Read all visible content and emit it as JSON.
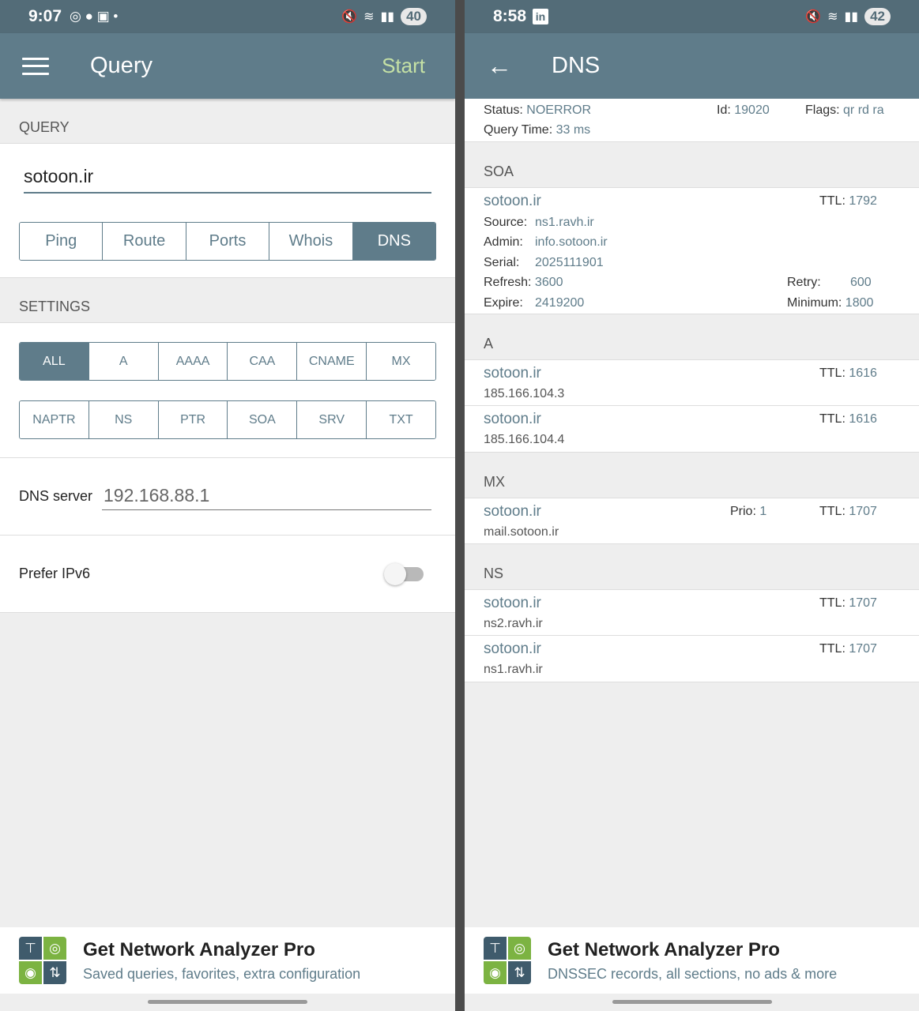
{
  "left": {
    "status_time": "9:07",
    "battery": "40",
    "title": "Query",
    "start_label": "Start",
    "query_section": "QUERY",
    "query_value": "sotoon.ir",
    "tools": [
      "Ping",
      "Route",
      "Ports",
      "Whois",
      "DNS"
    ],
    "tools_selected": "DNS",
    "settings_section": "SETTINGS",
    "record_types_row1": [
      "ALL",
      "A",
      "AAAA",
      "CAA",
      "CNAME",
      "MX"
    ],
    "record_types_row2": [
      "NAPTR",
      "NS",
      "PTR",
      "SOA",
      "SRV",
      "TXT"
    ],
    "record_selected": "ALL",
    "dns_server_label": "DNS server",
    "dns_server_value": "192.168.88.1",
    "prefer_ipv6_label": "Prefer IPv6",
    "prefer_ipv6": false,
    "promo_title": "Get Network Analyzer Pro",
    "promo_sub": "Saved queries, favorites, extra configuration"
  },
  "right": {
    "status_time": "8:58",
    "battery": "42",
    "title": "DNS",
    "header": {
      "status_label": "Status:",
      "status_value": "NOERROR",
      "id_label": "Id:",
      "id_value": "19020",
      "flags_label": "Flags:",
      "flags_value": "qr rd ra",
      "qtime_label": "Query Time:",
      "qtime_value": "33 ms"
    },
    "soa": {
      "section": "SOA",
      "name": "sotoon.ir",
      "ttl_label": "TTL:",
      "ttl": "1792",
      "source_label": "Source:",
      "source": "ns1.ravh.ir",
      "admin_label": "Admin:",
      "admin": "info.sotoon.ir",
      "serial_label": "Serial:",
      "serial": "2025111901",
      "refresh_label": "Refresh:",
      "refresh": "3600",
      "retry_label": "Retry:",
      "retry": "600",
      "expire_label": "Expire:",
      "expire": "2419200",
      "minimum_label": "Minimum:",
      "minimum": "1800"
    },
    "a": {
      "section": "A",
      "records": [
        {
          "name": "sotoon.ir",
          "ttl_label": "TTL:",
          "ttl": "1616",
          "value": "185.166.104.3"
        },
        {
          "name": "sotoon.ir",
          "ttl_label": "TTL:",
          "ttl": "1616",
          "value": "185.166.104.4"
        }
      ]
    },
    "mx": {
      "section": "MX",
      "name": "sotoon.ir",
      "prio_label": "Prio:",
      "prio": "1",
      "ttl_label": "TTL:",
      "ttl": "1707",
      "value": "mail.sotoon.ir"
    },
    "ns": {
      "section": "NS",
      "records": [
        {
          "name": "sotoon.ir",
          "ttl_label": "TTL:",
          "ttl": "1707",
          "value": "ns2.ravh.ir"
        },
        {
          "name": "sotoon.ir",
          "ttl_label": "TTL:",
          "ttl": "1707",
          "value": "ns1.ravh.ir"
        }
      ]
    },
    "promo_title": "Get Network Analyzer Pro",
    "promo_sub": "DNSSEC records, all sections, no ads & more"
  },
  "colors": {
    "appbar": "#5f7c8a",
    "statusbar": "#536c78",
    "accent_start": "#c5e1a5",
    "value_text": "#5f7c8a"
  },
  "icons": [
    "menu-icon",
    "back-arrow-icon",
    "network-analyzer-logo-icon"
  ]
}
